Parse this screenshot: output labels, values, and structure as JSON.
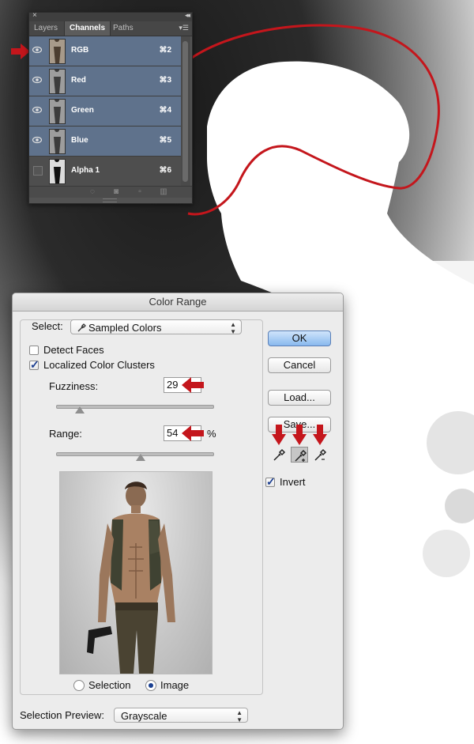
{
  "channels_panel": {
    "tabs": [
      {
        "label": "Layers"
      },
      {
        "label": "Channels",
        "active": true
      },
      {
        "label": "Paths"
      }
    ],
    "rows": [
      {
        "name": "RGB",
        "shortcut": "⌘2",
        "visible": true
      },
      {
        "name": "Red",
        "shortcut": "⌘3",
        "visible": true
      },
      {
        "name": "Green",
        "shortcut": "⌘4",
        "visible": true
      },
      {
        "name": "Blue",
        "shortcut": "⌘5",
        "visible": true
      },
      {
        "name": "Alpha 1",
        "shortcut": "⌘6",
        "visible": false
      }
    ]
  },
  "dialog": {
    "title": "Color Range",
    "select_label": "Select:",
    "select_value": "Sampled Colors",
    "detect_faces_label": "Detect Faces",
    "detect_faces_checked": false,
    "localized_label": "Localized Color Clusters",
    "localized_checked": true,
    "fuzziness_label": "Fuzziness:",
    "fuzziness_value": "29",
    "range_label": "Range:",
    "range_value": "54",
    "range_unit": "%",
    "fuzziness_fraction": 0.15,
    "range_fraction": 0.54,
    "radio_selection": "Selection",
    "radio_image": "Image",
    "radio_selected": "Image",
    "preview_label": "Selection Preview:",
    "preview_value": "Grayscale",
    "buttons": {
      "ok": "OK",
      "cancel": "Cancel",
      "load": "Load...",
      "save": "Save..."
    },
    "invert_label": "Invert",
    "invert_checked": true,
    "active_eyedropper": "add-to-sample"
  },
  "colors": {
    "panel_row_selected": "#5f728c",
    "annotation_red": "#c4161c",
    "ok_button": "#89b9ee"
  }
}
